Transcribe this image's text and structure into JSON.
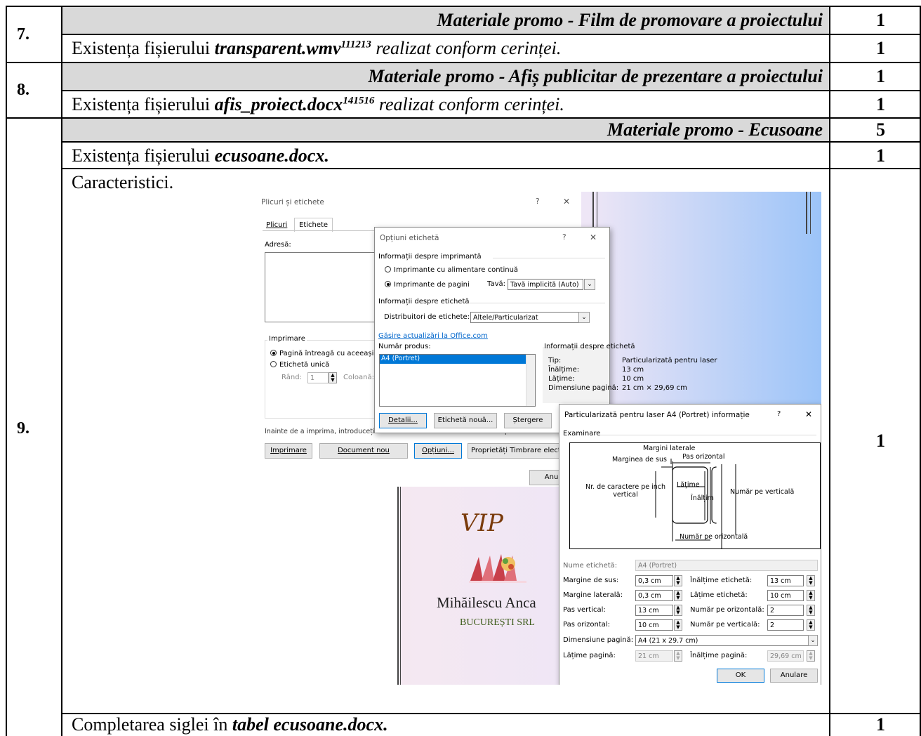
{
  "rows": {
    "r7": {
      "number": "7.",
      "header": "Materiale promo - Film de promovare a proiectului",
      "header_points": "1",
      "item_prefix": "Existența fișierului ",
      "item_file": "transparent.wmv",
      "item_sup": "111213",
      "item_suffix": " realizat conform cerinței.",
      "item_points": "1"
    },
    "r8": {
      "number": "8.",
      "header": "Materiale promo - Afiș publicitar de prezentare a proiectului",
      "header_points": "1",
      "item_prefix": "Existența fișierului ",
      "item_file": "afis_proiect.docx",
      "item_sup": "141516",
      "item_suffix": " realizat conform cerinței.",
      "item_points": "1"
    },
    "r9": {
      "number": "9.",
      "header": "Materiale promo - Ecusoane",
      "header_points": "5",
      "item1_prefix": "Existența fișierului ",
      "item1_file": "ecusoane.docx.",
      "item1_points": "1",
      "item2_label": "Caracteristici.",
      "item2_points": "1",
      "item3_prefix": "Completarea siglei în ",
      "item3_file": "tabel ecusoane.docx.",
      "item3_points": "1"
    }
  },
  "screenshot": {
    "badge": {
      "title": "VIP",
      "name": "Mihăilescu Anca",
      "company": "BUCUREȘTI SRL"
    },
    "dlg_envelopes": {
      "title": "Plicuri și etichete",
      "help": "?",
      "close": "✕",
      "tab_envelopes": "Plicuri",
      "tab_labels": "Etichete",
      "address_label": "Adresă:",
      "print_group": "Imprimare",
      "opt_full_page": "Pagină întreagă cu aceeași e",
      "opt_single": "Etichetă unică",
      "row_label": "Rând:",
      "row_value": "1",
      "col_label": "Coloană:",
      "note": "Înainte de a imprima, introduceți etichete în alimentatorul manual al imprimantei.",
      "btn_print": "Imprimare",
      "btn_new_doc": "Document nou",
      "btn_options": "Opțiuni...",
      "btn_stamps": "Proprietăți Timbrare electr",
      "btn_cancel": "Anula"
    },
    "dlg_options": {
      "title": "Opțiuni etichetă",
      "help": "?",
      "close": "✕",
      "printer_info": "Informații despre imprimantă",
      "opt_continuous": "Imprimante cu alimentare continuă",
      "opt_pages": "Imprimante de pagini",
      "tray_label": "Tavă:",
      "tray_value": "Tavă implicită (Auto)",
      "label_info": "Informații despre etichetă",
      "vendors_label": "Distribuitori de etichete:",
      "vendors_value": "Altele/Particularizat",
      "update_link": "Găsire actualizări la Office.com",
      "product_label": "Număr produs:",
      "product_item": "A4 (Portret)",
      "info_group": "Informații despre etichetă",
      "type_label": "Tip:",
      "type_value": "Particularizată pentru laser",
      "height_label": "Înălțime:",
      "height_value": "13 cm",
      "width_label": "Lățime:",
      "width_value": "10 cm",
      "page_label": "Dimensiune pagină:",
      "page_value": "21 cm × 29,69 cm",
      "btn_details": "Detalii...",
      "btn_new_label": "Etichetă nouă...",
      "btn_delete": "Ștergere"
    },
    "dlg_details": {
      "title": "Particularizată pentru laser A4 (Portret) informație",
      "help": "?",
      "close": "✕",
      "preview_label": "Examinare",
      "d_side_margins": "Margini laterale",
      "d_top_margin": "Marginea de sus",
      "d_h_pitch": "Pas orizontal",
      "d_chars": "Nr. de caractere pe inch vertical",
      "d_width": "Lățime",
      "d_height": "Înălțim",
      "d_num_down": "Număr pe verticală",
      "d_num_across": "Număr pe orizontală",
      "name_label": "Nume etichetă:",
      "name_value": "A4 (Portret)",
      "top_margin_label": "Margine de sus:",
      "top_margin_value": "0,3 cm",
      "side_margin_label": "Margine laterală:",
      "side_margin_value": "0,3 cm",
      "v_pitch_label": "Pas vertical:",
      "v_pitch_value": "13 cm",
      "h_pitch_label": "Pas orizontal:",
      "h_pitch_value": "10 cm",
      "label_height_label": "Înălțime etichetă:",
      "label_height_value": "13 cm",
      "label_width_label": "Lățime etichetă:",
      "label_width_value": "10 cm",
      "num_across_label": "Număr pe orizontală:",
      "num_across_value": "2",
      "num_down_label": "Număr pe verticală:",
      "num_down_value": "2",
      "page_size_label": "Dimensiune pagină:",
      "page_size_value": "A4 (21 x 29.7 cm)",
      "page_width_label": "Lățime pagină:",
      "page_width_value": "21 cm",
      "page_height_label": "Înălțime pagină:",
      "page_height_value": "29,69 cm",
      "btn_ok": "OK",
      "btn_cancel": "Anulare"
    }
  }
}
